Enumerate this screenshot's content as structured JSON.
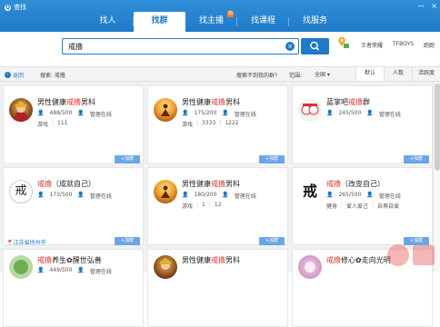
{
  "app": {
    "title": "查找"
  },
  "window": {
    "min": "—",
    "close": "×"
  },
  "nav": [
    {
      "label": "找人"
    },
    {
      "label": "找群",
      "active": true
    },
    {
      "label": "找主播",
      "badge": "热"
    },
    {
      "label": "找课程"
    },
    {
      "label": "找服务"
    }
  ],
  "search": {
    "value": "戒撸"
  },
  "hot_tags": [
    "王者荣耀",
    "TFBOYS",
    "跑跑"
  ],
  "filterbar": {
    "back": "返回",
    "crumb": "搜索: 戒撸",
    "notfound": "搜索不到我的群?",
    "range_label": "范围:",
    "range_value": "全国 ▾",
    "sort": [
      "默认",
      "人数",
      "活跃度"
    ]
  },
  "cards": [
    {
      "pre": "男性健康",
      "hl": "戒撸",
      "post": "男科",
      "members": "488/500",
      "admin": "管理在线",
      "t1": "游戏",
      "t2": "111",
      "loc": ""
    },
    {
      "pre": "男性健康",
      "hl": "戒撸",
      "post": "男科",
      "members": "175/200",
      "admin": "管理在线",
      "t1": "游戏",
      "t2": "3333",
      "t3": "1222",
      "loc": ""
    },
    {
      "pre": "蓝掌吧",
      "hl": "戒撸",
      "post": "群",
      "members": "245/500",
      "admin": "管理在线",
      "t1": "",
      "t2": "",
      "loc": ""
    },
    {
      "pre": "",
      "hl": "戒撸",
      "post": "（成就自己）",
      "members": "173/500",
      "admin": "管理在线",
      "t1": "",
      "t2": "",
      "loc": "江苏省徐州市"
    },
    {
      "pre": "男性健康",
      "hl": "戒撸",
      "post": "男科",
      "members": "180/200",
      "admin": "管理在线",
      "t1": "游戏",
      "t2": "1",
      "t3": "12",
      "loc": ""
    },
    {
      "pre": "",
      "hl": "戒撸",
      "post": "（改变自己）",
      "members": "265/500",
      "admin": "管理在线",
      "t1": "健身",
      "t2": "爱人爱己",
      "t3": "自尊自爱",
      "loc": ""
    },
    {
      "pre": "",
      "hl": "戒撸",
      "post": "养生✿醒世弘善",
      "members": "449/500",
      "admin": "管理在线",
      "t1": "",
      "t2": "",
      "loc": ""
    },
    {
      "pre": "男性健康",
      "hl": "戒撸",
      "post": "男科",
      "members": "",
      "admin": "",
      "t1": "",
      "t2": "",
      "loc": ""
    },
    {
      "pre": "",
      "hl": "戒撸",
      "post": "修心✿走向光明",
      "members": "",
      "admin": "",
      "t1": "",
      "t2": "",
      "loc": ""
    }
  ],
  "join_label": "+加群",
  "avatar_glyphs": {
    "jie": "戒"
  }
}
